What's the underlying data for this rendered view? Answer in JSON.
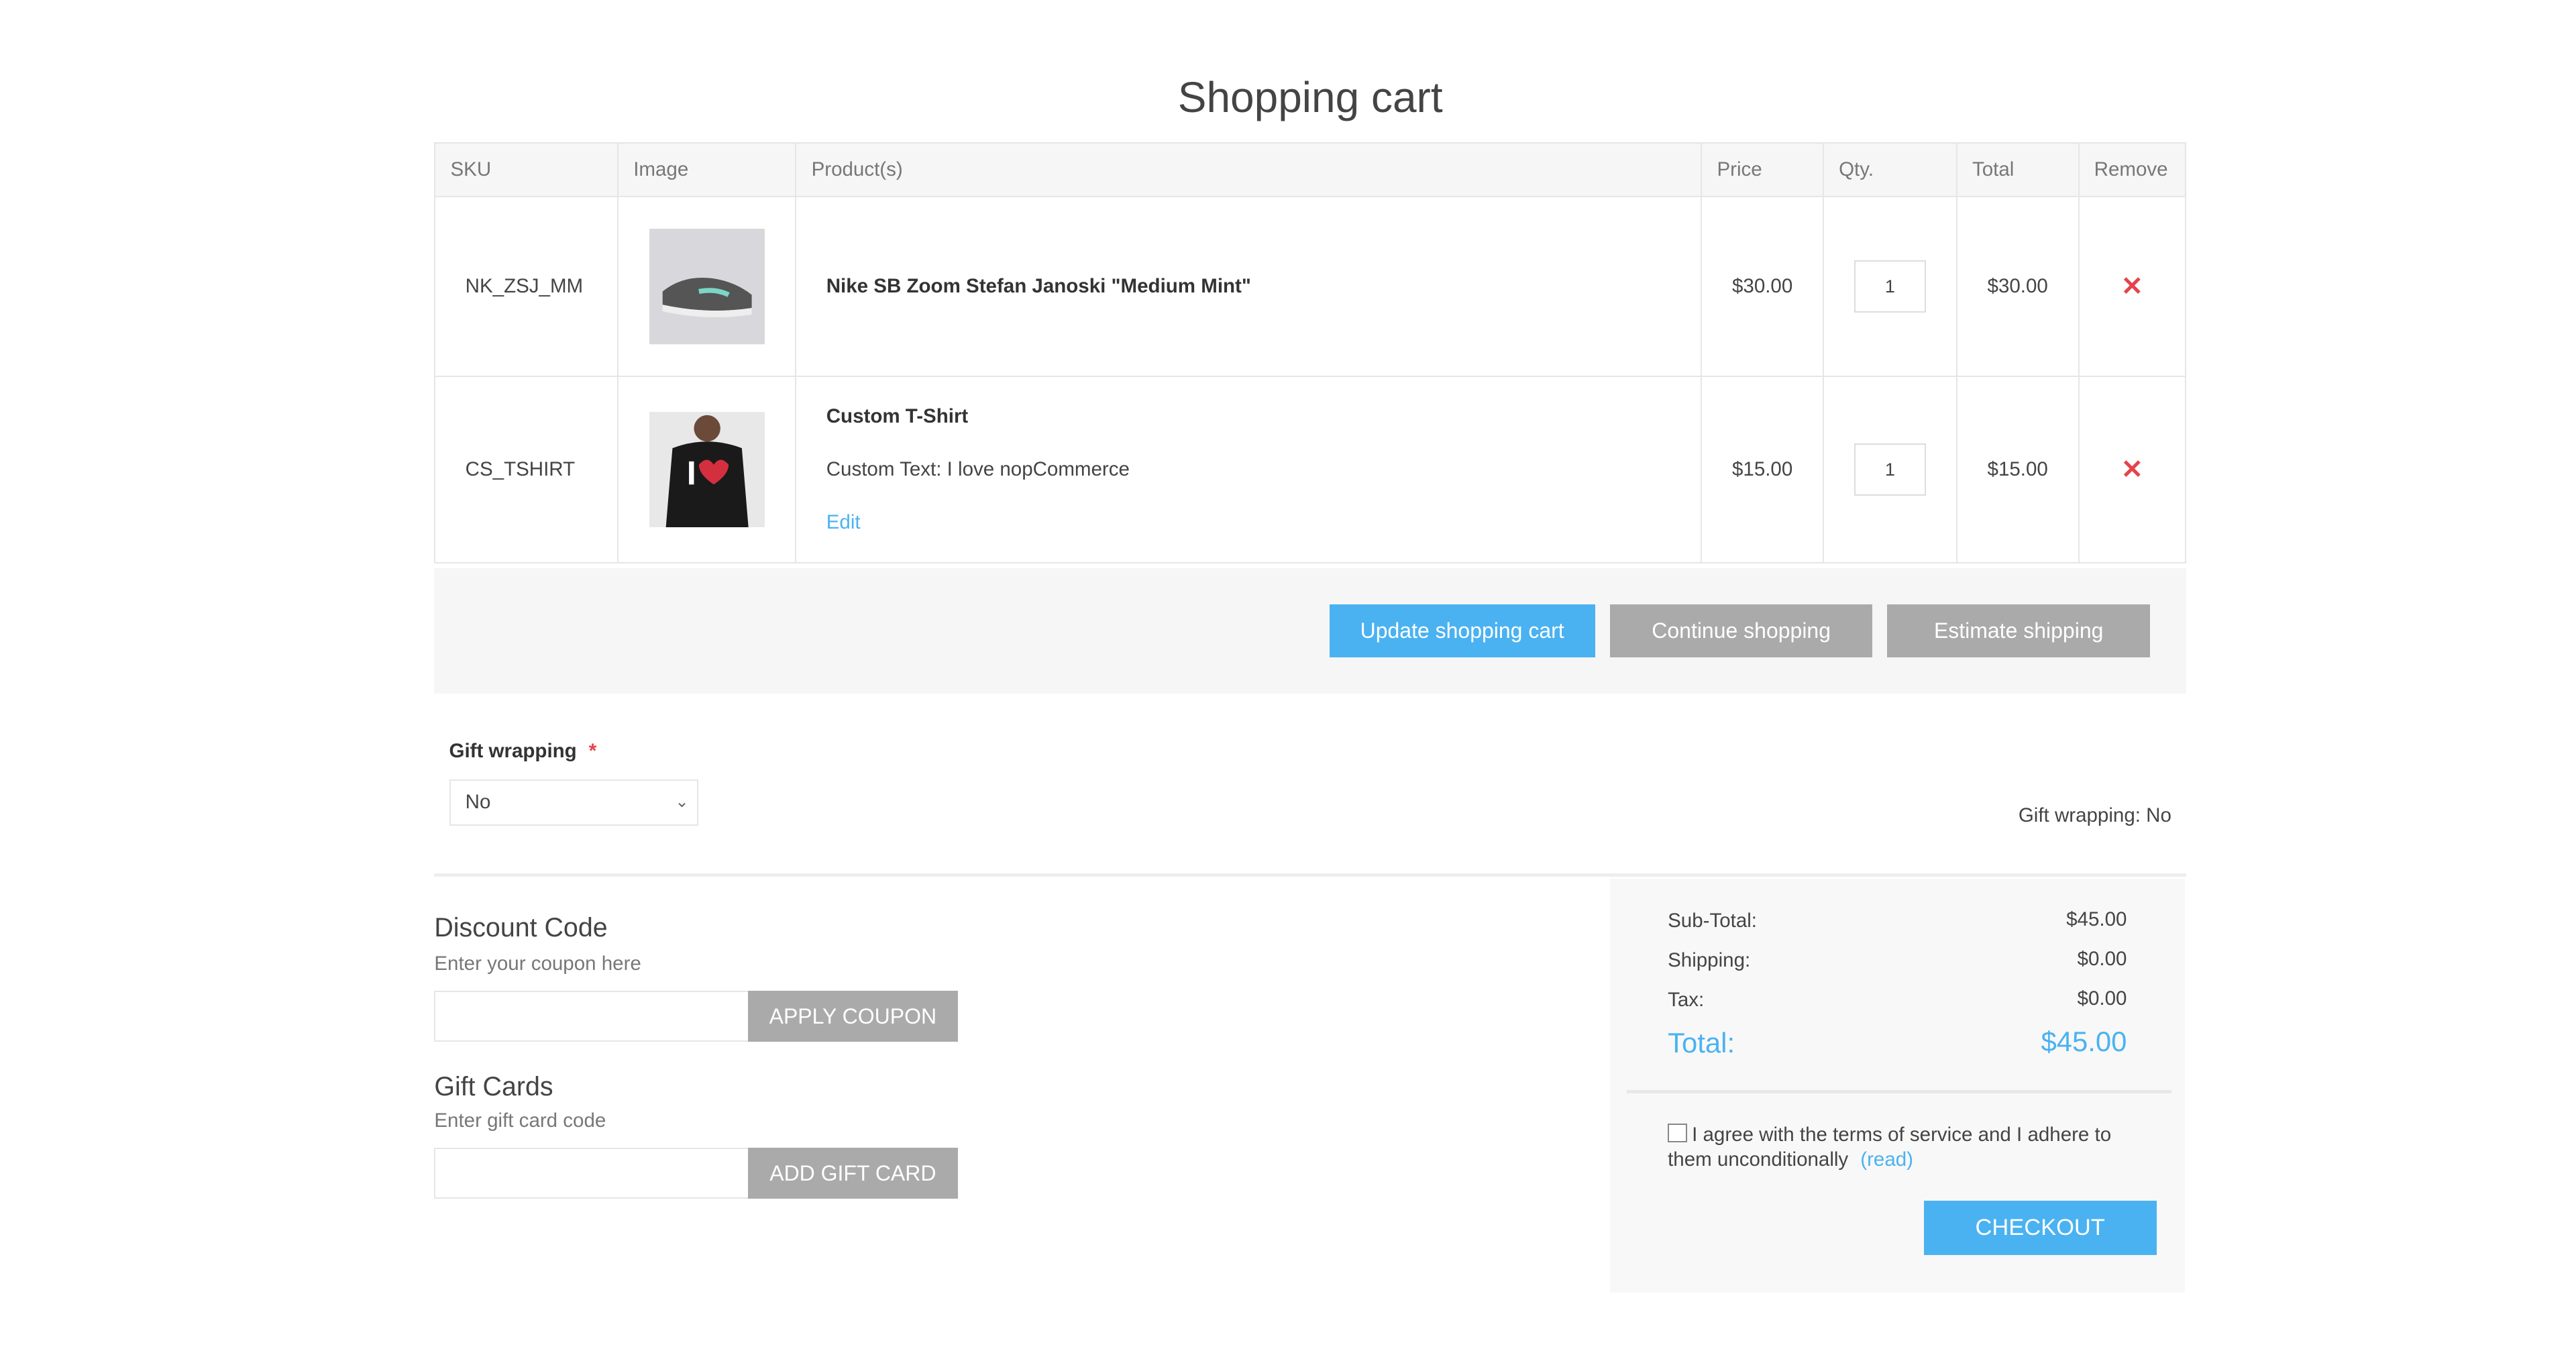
{
  "page_title": "Shopping cart",
  "table": {
    "headers": [
      "SKU",
      "Image",
      "Product(s)",
      "Price",
      "Qty.",
      "Total",
      "Remove"
    ],
    "rows": [
      {
        "sku": "NK_ZSJ_MM",
        "image": "shoe-thumbnail",
        "name": "Nike SB Zoom Stefan Janoski \"Medium Mint\"",
        "price": "$30.00",
        "qty": "1",
        "total": "$30.00"
      },
      {
        "sku": "CS_TSHIRT",
        "image": "tshirt-thumbnail",
        "name": "Custom T-Shirt",
        "attr": "Custom Text: I love nopCommerce",
        "edit": "Edit",
        "price": "$15.00",
        "qty": "1",
        "total": "$15.00"
      }
    ],
    "remove_icon": "close-x-icon"
  },
  "buttons": {
    "update": "Update shopping cart",
    "continue": "Continue shopping",
    "estimate": "Estimate shipping"
  },
  "gift_wrapping": {
    "label": "Gift wrapping",
    "required": "*",
    "selected": "No",
    "summary": "Gift wrapping: No"
  },
  "discount": {
    "title": "Discount Code",
    "hint": "Enter your coupon here",
    "value": "",
    "button": "APPLY COUPON"
  },
  "gift_cards": {
    "title": "Gift Cards",
    "hint": "Enter gift card code",
    "value": "",
    "button": "ADD GIFT CARD"
  },
  "totals": {
    "subtotal_label": "Sub-Total:",
    "subtotal": "$45.00",
    "shipping_label": "Shipping:",
    "shipping": "$0.00",
    "tax_label": "Tax:",
    "tax": "$0.00",
    "total_label": "Total:",
    "total": "$45.00"
  },
  "terms": {
    "text": "I agree with the terms of service and I adhere to them unconditionally",
    "link": "(read)",
    "checked": false
  },
  "checkout": "CHECKOUT",
  "colors": {
    "accent": "#4ab2f1",
    "remove": "#e4434b",
    "secondary_button": "#aaaaaa"
  }
}
